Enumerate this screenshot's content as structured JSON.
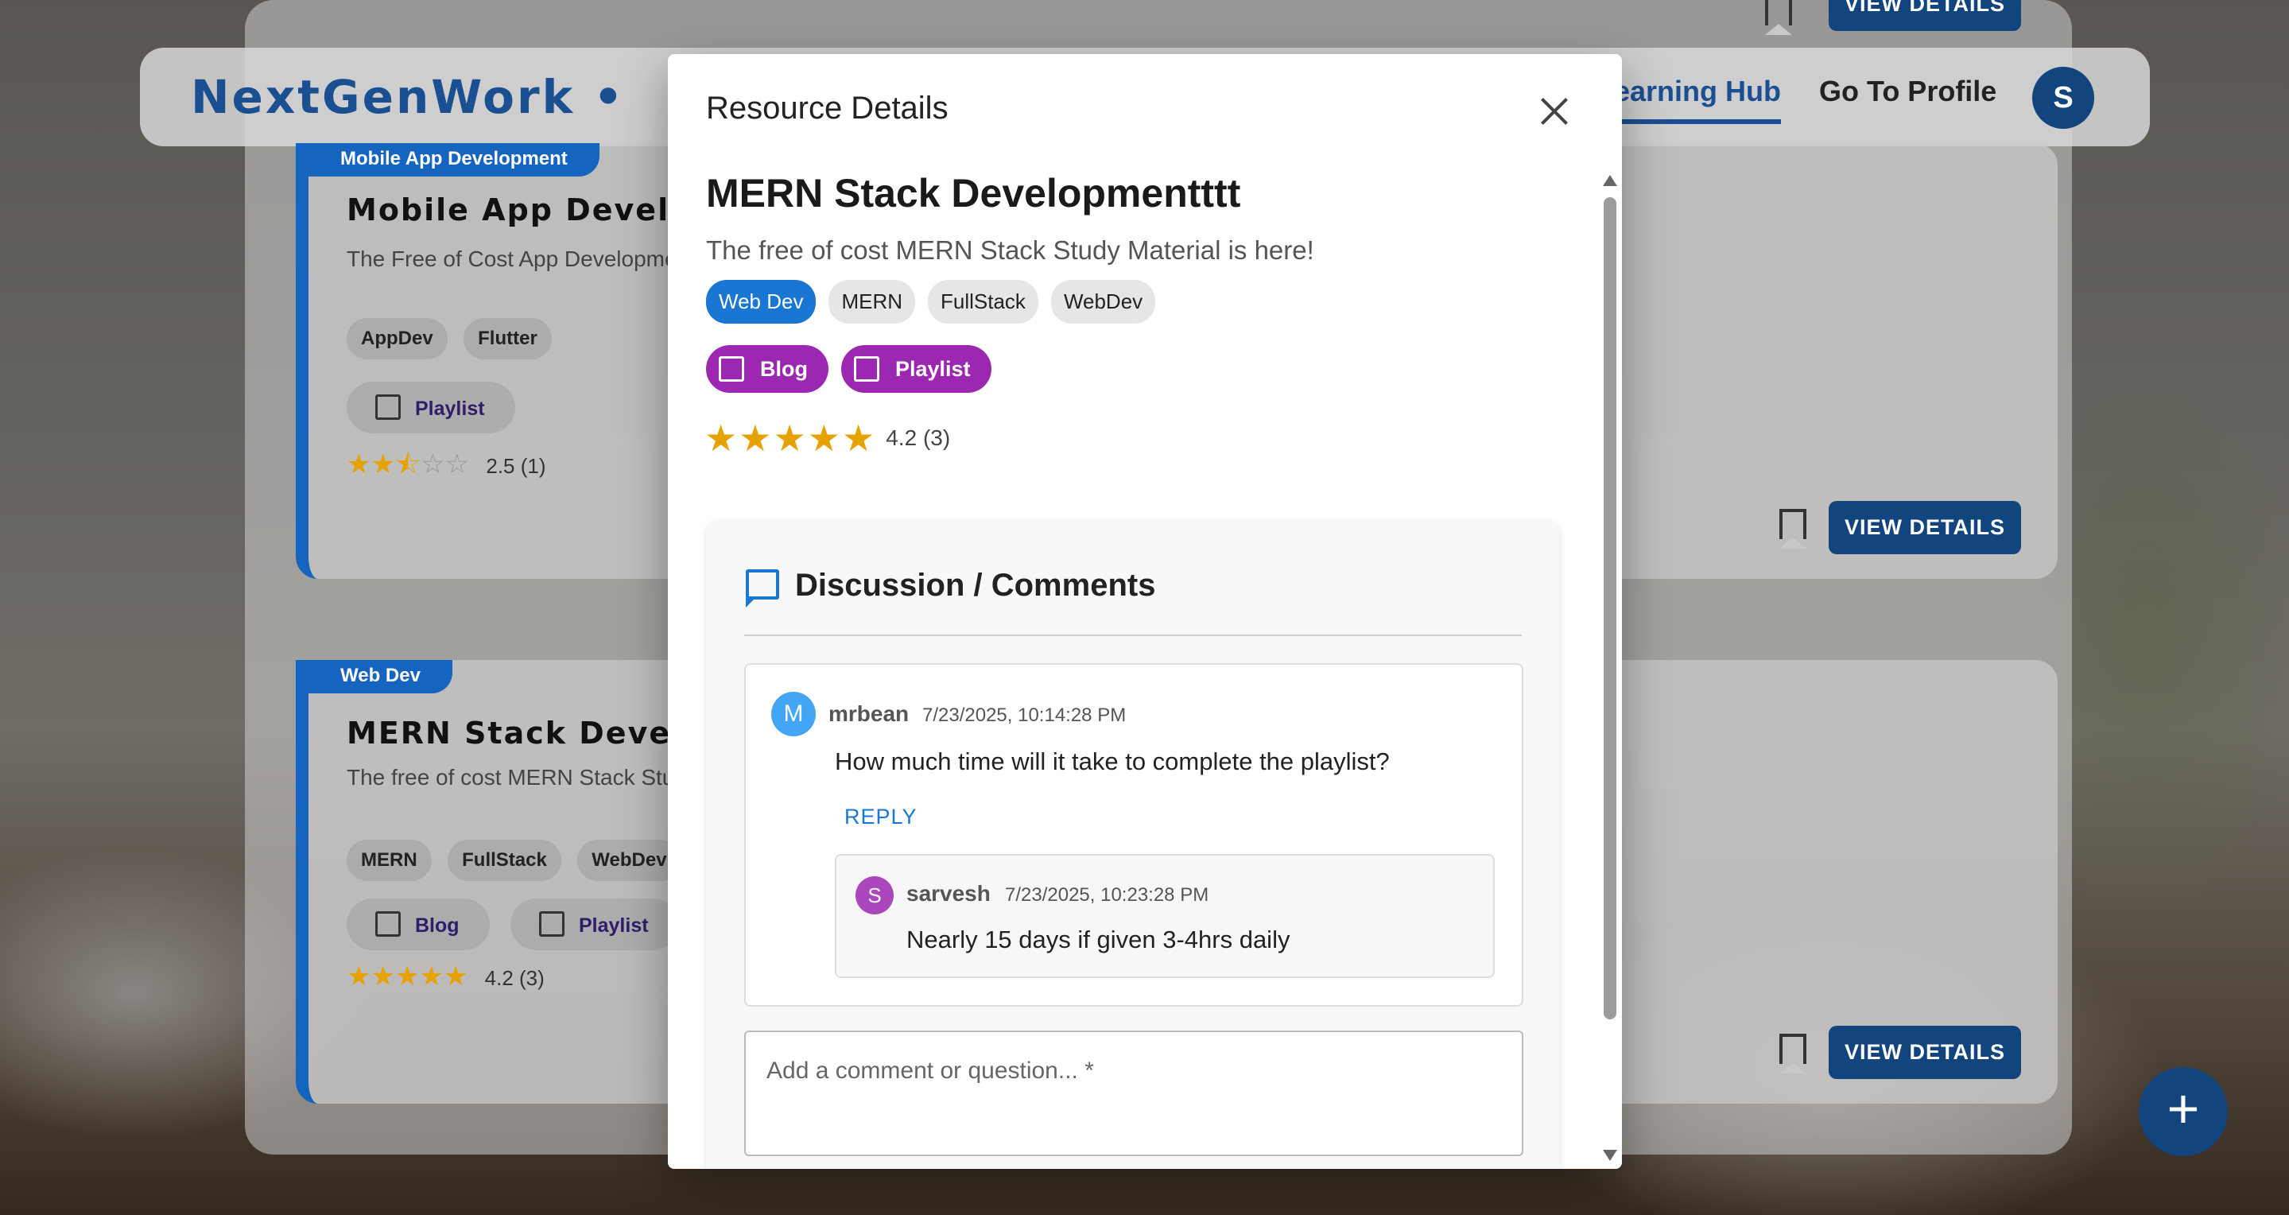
{
  "navbar": {
    "brand": "NextGenWork •",
    "learning_hub": "earning Hub",
    "go_to_profile": "Go To Profile",
    "avatar_letter": "S"
  },
  "cards": [
    {
      "category": "Mobile App Development",
      "title": "Mobile App Develop",
      "description": "The Free of Cost App Developme",
      "tags": [
        "AppDev",
        "Flutter"
      ],
      "links": [
        "Playlist"
      ],
      "rating_text": "2.5 (1)",
      "rating": 2.5,
      "view_details": "VIEW DETAILS"
    },
    {
      "category": "Web Dev",
      "title": "MERN Stack Develop",
      "description": "The free of cost MERN Stack Stu",
      "tags": [
        "MERN",
        "FullStack",
        "WebDev"
      ],
      "links": [
        "Blog",
        "Playlist"
      ],
      "rating_text": "4.2 (3)",
      "rating": 4.2,
      "view_details": "VIEW DETAILS"
    }
  ],
  "top_card_view_details": "VIEW DETAILS",
  "fab_label": "+",
  "modal": {
    "title": "Resource Details",
    "resource": {
      "title": "MERN Stack Developmentttt",
      "description": "The free of cost MERN Stack Study Material is here!",
      "category_tag": "Web Dev",
      "tags": [
        "MERN",
        "FullStack",
        "WebDev"
      ],
      "links": [
        "Blog",
        "Playlist"
      ],
      "rating": 4.2,
      "rating_text": "4.2 (3)"
    },
    "discussion": {
      "title": "Discussion / Comments",
      "comments": [
        {
          "avatar": "M",
          "user": "mrbean",
          "time": "7/23/2025, 10:14:28 PM",
          "text": "How much time will it take to complete the playlist?",
          "reply_label": "REPLY",
          "replies": [
            {
              "avatar": "S",
              "user": "sarvesh",
              "time": "7/23/2025, 10:23:28 PM",
              "text": "Nearly 15 days if given 3-4hrs daily"
            }
          ]
        }
      ],
      "input_placeholder": "Add a comment or question... *"
    }
  },
  "colors": {
    "primary": "#1565c0",
    "brand": "#1a4f92",
    "link_purple": "#9c27b0",
    "star": "#e5a200"
  }
}
